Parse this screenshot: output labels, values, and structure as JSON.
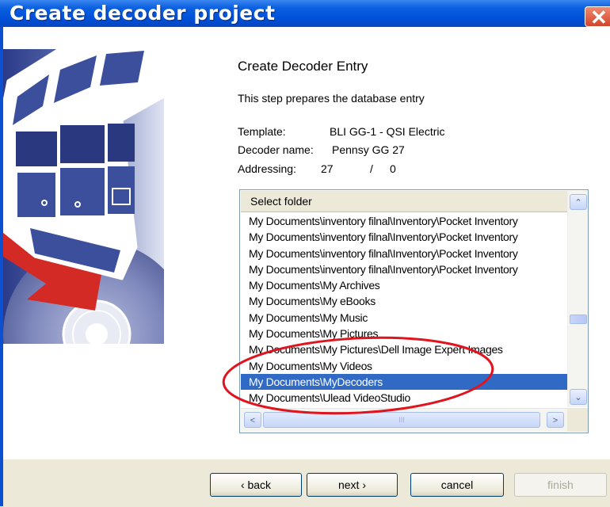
{
  "window": {
    "title": "Create decoder project",
    "close_glyph": "✕"
  },
  "step": {
    "heading": "Create Decoder Entry",
    "description": "This step prepares the database entry"
  },
  "info": {
    "template_label": "Template:",
    "template_value": "BLI GG-1 - QSI Electric",
    "decoder_name_label": "Decoder name:",
    "decoder_name_value": "Pennsy GG 27",
    "addressing_label": "Addressing:",
    "addressing_primary": "27",
    "addressing_separator": "/",
    "addressing_secondary": "0"
  },
  "folder_list": {
    "header": "Select folder",
    "items": [
      "My Documents\\inventory filnal\\Inventory\\Pocket Inventory",
      "My Documents\\inventory filnal\\Inventory\\Pocket Inventory",
      "My Documents\\inventory filnal\\Inventory\\Pocket Inventory",
      "My Documents\\inventory filnal\\Inventory\\Pocket Inventory",
      "My Documents\\My Archives",
      "My Documents\\My eBooks",
      "My Documents\\My Music",
      "My Documents\\My Pictures",
      "My Documents\\My Pictures\\Dell Image Expert Images",
      "My Documents\\My Videos",
      "My Documents\\MyDecoders",
      "My Documents\\Ulead VideoStudio"
    ],
    "selected_index": 10,
    "scroll_up_glyph": "⌃",
    "scroll_down_glyph": "⌄",
    "scroll_left_glyph": "<",
    "scroll_right_glyph": ">",
    "hscroll_grip": "III"
  },
  "buttons": {
    "back": "‹ back",
    "next": "next ›",
    "cancel": "cancel",
    "finish": "finish"
  },
  "colors": {
    "title_bar": "#0050d8",
    "selection": "#316ac5",
    "annotation_ellipse": "#e0141e",
    "banner_blue": "#3c4f9c",
    "banner_arrow": "#d42a26"
  },
  "icons": [
    "close-icon",
    "locomotive-illustration",
    "arrow-illustration",
    "disc-illustration"
  ]
}
